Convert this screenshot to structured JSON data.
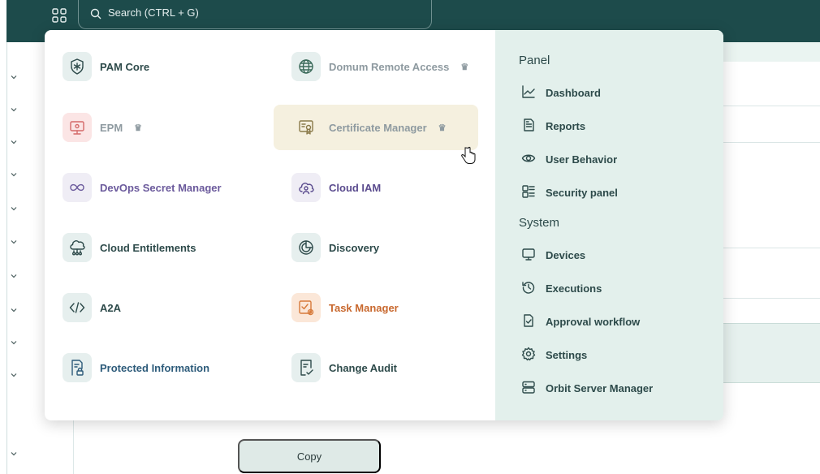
{
  "search": {
    "placeholder": "Search (CTRL + G)"
  },
  "products": [
    {
      "label": "PAM Core",
      "icon": "shield-asterisk-icon",
      "color": "#2d4a4a",
      "premium": false
    },
    {
      "label": "Domum Remote Access",
      "icon": "globe-icon",
      "color": "#8e9aa0",
      "premium": true
    },
    {
      "label": "EPM",
      "icon": "monitor-icon",
      "color": "#8e9aa0",
      "premium": true
    },
    {
      "label": "Certificate Manager",
      "icon": "certificate-icon",
      "color": "#8e9aa0",
      "premium": true
    },
    {
      "label": "DevOps Secret Manager",
      "icon": "infinity-icon",
      "color": "#6b5a9c",
      "premium": false
    },
    {
      "label": "Cloud IAM",
      "icon": "cloud-user-icon",
      "color": "#5a4b8e",
      "premium": false
    },
    {
      "label": "Cloud Entitlements",
      "icon": "cloud-network-icon",
      "color": "#2d4a4a",
      "premium": false
    },
    {
      "label": "Discovery",
      "icon": "pie-chart-icon",
      "color": "#2d4a4a",
      "premium": false
    },
    {
      "label": "A2A",
      "icon": "code-icon",
      "color": "#2d4a4a",
      "premium": false
    },
    {
      "label": "Task Manager",
      "icon": "task-icon",
      "color": "#c8682e",
      "premium": false
    },
    {
      "label": "Protected Information",
      "icon": "protected-doc-icon",
      "color": "#2d5b7a",
      "premium": false
    },
    {
      "label": "Change Audit",
      "icon": "audit-doc-icon",
      "color": "#2d4a4a",
      "premium": false
    }
  ],
  "panel": {
    "title": "Panel",
    "items": [
      {
        "label": "Dashboard",
        "icon": "chart-line-icon"
      },
      {
        "label": "Reports",
        "icon": "report-icon"
      },
      {
        "label": "User Behavior",
        "icon": "eye-icon"
      },
      {
        "label": "Security panel",
        "icon": "grid-panel-icon"
      }
    ]
  },
  "system": {
    "title": "System",
    "items": [
      {
        "label": "Devices",
        "icon": "device-icon"
      },
      {
        "label": "Executions",
        "icon": "history-icon"
      },
      {
        "label": "Approval workflow",
        "icon": "approval-icon"
      },
      {
        "label": "Settings",
        "icon": "gear-icon"
      },
      {
        "label": "Orbit Server Manager",
        "icon": "server-icon"
      }
    ]
  },
  "page": {
    "copy_label": "Copy"
  },
  "colors": {
    "topbar": "#1d4b4b",
    "panel_bg": "#e3f0ec",
    "hover_bg": "#f5f0df"
  }
}
